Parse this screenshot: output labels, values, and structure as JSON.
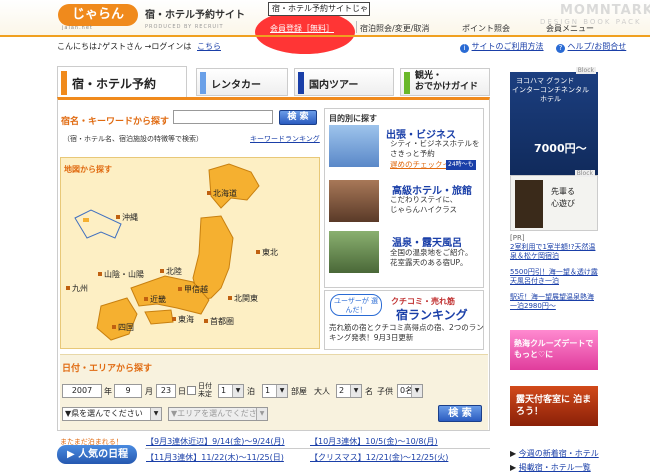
{
  "header": {
    "logo": "じゃらん",
    "logo_sub": "jalan.net",
    "site_title": "宿・ホテル予約サイト",
    "produced_by": "PRODUCED BY RECRUIT",
    "url_box": "宿・ホテル予約サイトじゃらんnet",
    "register": "会員登録［無料］",
    "nav": [
      "宿泊照会/変更/取消",
      "ポイント照会",
      "会員メニュー"
    ],
    "watermark": "MOMNTARK",
    "watermark_sub": "DESIGN BOOK PACK"
  },
  "greeting": {
    "text": "こんにちは♪ゲストさん →ログインは",
    "login_link": "こちら",
    "guide_link": "サイトのご利用方法",
    "help_link": "ヘルプ/お問合せ"
  },
  "tabs": {
    "hotel": "宿・ホテル予約",
    "rental": "レンタカー",
    "tour": "国内ツアー",
    "guide_line1": "観光・",
    "guide_line2": "おでかけガイド"
  },
  "keyword": {
    "label": "宿名・キーワードから探す",
    "button": "検 索",
    "note": "（宿・ホテル名、宿泊施設の特徴等で検索）",
    "ranking_link": "キーワードランキング"
  },
  "map": {
    "label": "地図から探す",
    "regions": [
      "北海道",
      "沖縄",
      "東北",
      "山陰・山陽",
      "北陸",
      "九州",
      "甲信越",
      "近畿",
      "北関東",
      "四国",
      "東海",
      "首都圏"
    ]
  },
  "purpose": {
    "label": "目的別に探す",
    "items": [
      {
        "title": "出張・ビジネス",
        "desc1": "シティ・ビジネスホテルを",
        "desc2": "さきっと予約",
        "desc3": "遅めのチェックイン",
        "badge": "24時～も"
      },
      {
        "title": "高級ホテル・旅館",
        "desc1": "こだわりステイに、",
        "desc2": "じゃらんハイクラス",
        "desc3": "",
        "badge": ""
      },
      {
        "title": "温泉・露天風呂",
        "desc1": "全国の温泉地をご紹介。",
        "desc2": "花室露天のある宿UP。",
        "desc3": "",
        "badge": ""
      }
    ]
  },
  "ranking": {
    "bubble": "ユーザーが 選んだ！",
    "sub": "クチコミ・売れ筋",
    "title": "宿ランキング",
    "desc": "売れ筋の宿とクチコミ高得点の宿、2つのランキング発表！9月3日更新"
  },
  "date_search": {
    "label": "日付・エリアから探す",
    "year": "2007",
    "year_unit": "年",
    "month": "9",
    "month_unit": "月",
    "day": "23",
    "day_unit": "日",
    "undecided": "日付未定",
    "nights": "1",
    "nights_unit": "泊",
    "rooms": "1",
    "rooms_unit": "部屋",
    "adults_label": "大人",
    "adults": "2",
    "adults_unit": "名",
    "children_label": "子供",
    "children": "0名",
    "pref_select": "▼県を選んでください",
    "area_select": "▼エリアを選んでください",
    "button": "検 索"
  },
  "popular": {
    "sub": "またまだ泊まれる！",
    "tab": "人気の日程",
    "schedules": [
      "【9月3連休近辺】9/14(金)～9/24(月)",
      "【10月3連休】10/5(金)～10/8(月)",
      "【11月3連休】11/22(木)～11/25(日)",
      "【クリスマス】12/21(金)～12/25(火)"
    ]
  },
  "right": {
    "block_tag": "Block",
    "ad1_l1": "ヨコハマ グランド",
    "ad1_l2": "インターコンチネンタル",
    "ad1_l3": "ホテル",
    "ad1_price": "7000円～",
    "ad2_l1": "先輩る",
    "ad2_l2": "心遊び",
    "pr_label": "[PR]",
    "pr_items": [
      "2室利用で1室半額!?天然温泉＆松ケ岡宿泊",
      "5500円引！海一望＆透け露天風呂付き一泊",
      "駅近！海一望展望温泉熱海一泊2980円～"
    ],
    "ad3": "熱海クルーズデートで もっと♡に",
    "ad4": "露天付客室に 泊まろう！",
    "links": [
      "今週の新着宿・ホテル",
      "掲載宿・ホテル一覧"
    ]
  }
}
